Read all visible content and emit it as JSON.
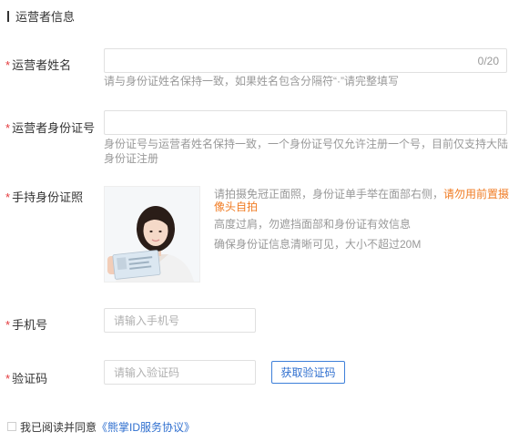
{
  "section": {
    "title": "运营者信息"
  },
  "fields": {
    "required_mark": "*",
    "name": {
      "label": "运营者姓名",
      "counter": "0/20",
      "hint": "请与身份证姓名保持一致，如果姓名包含分隔符“·”请完整填写"
    },
    "id_number": {
      "label": "运营者身份证号",
      "hint_line1": "身份证号与运营者姓名保持一致，一个身份证号仅允许注册一个号，目前仅支持大陆",
      "hint_line2": "身份证注册"
    },
    "id_photo": {
      "label": "手持身份证照",
      "hint1_line1_a": "请拍摄免冠正面照，身份证单手举在面部右侧，",
      "hint1_line1_b": "请勿用前置摄",
      "hint1_line2": "像头自拍",
      "hint2": "高度过肩，勿遮挡面部和身份证有效信息",
      "hint3": "确保身份证信息清晰可见，大小不超过20M"
    },
    "phone": {
      "label": "手机号",
      "placeholder": "请输入手机号"
    },
    "code": {
      "label": "验证码",
      "placeholder": "请输入验证码",
      "button": "获取验证码"
    }
  },
  "agreement": {
    "text": "我已阅读并同意",
    "link": "《熊掌ID服务协议》",
    "checked": false
  },
  "colors": {
    "required": "#e4393c",
    "warning": "#f07c24",
    "link": "#2f6fcf"
  }
}
